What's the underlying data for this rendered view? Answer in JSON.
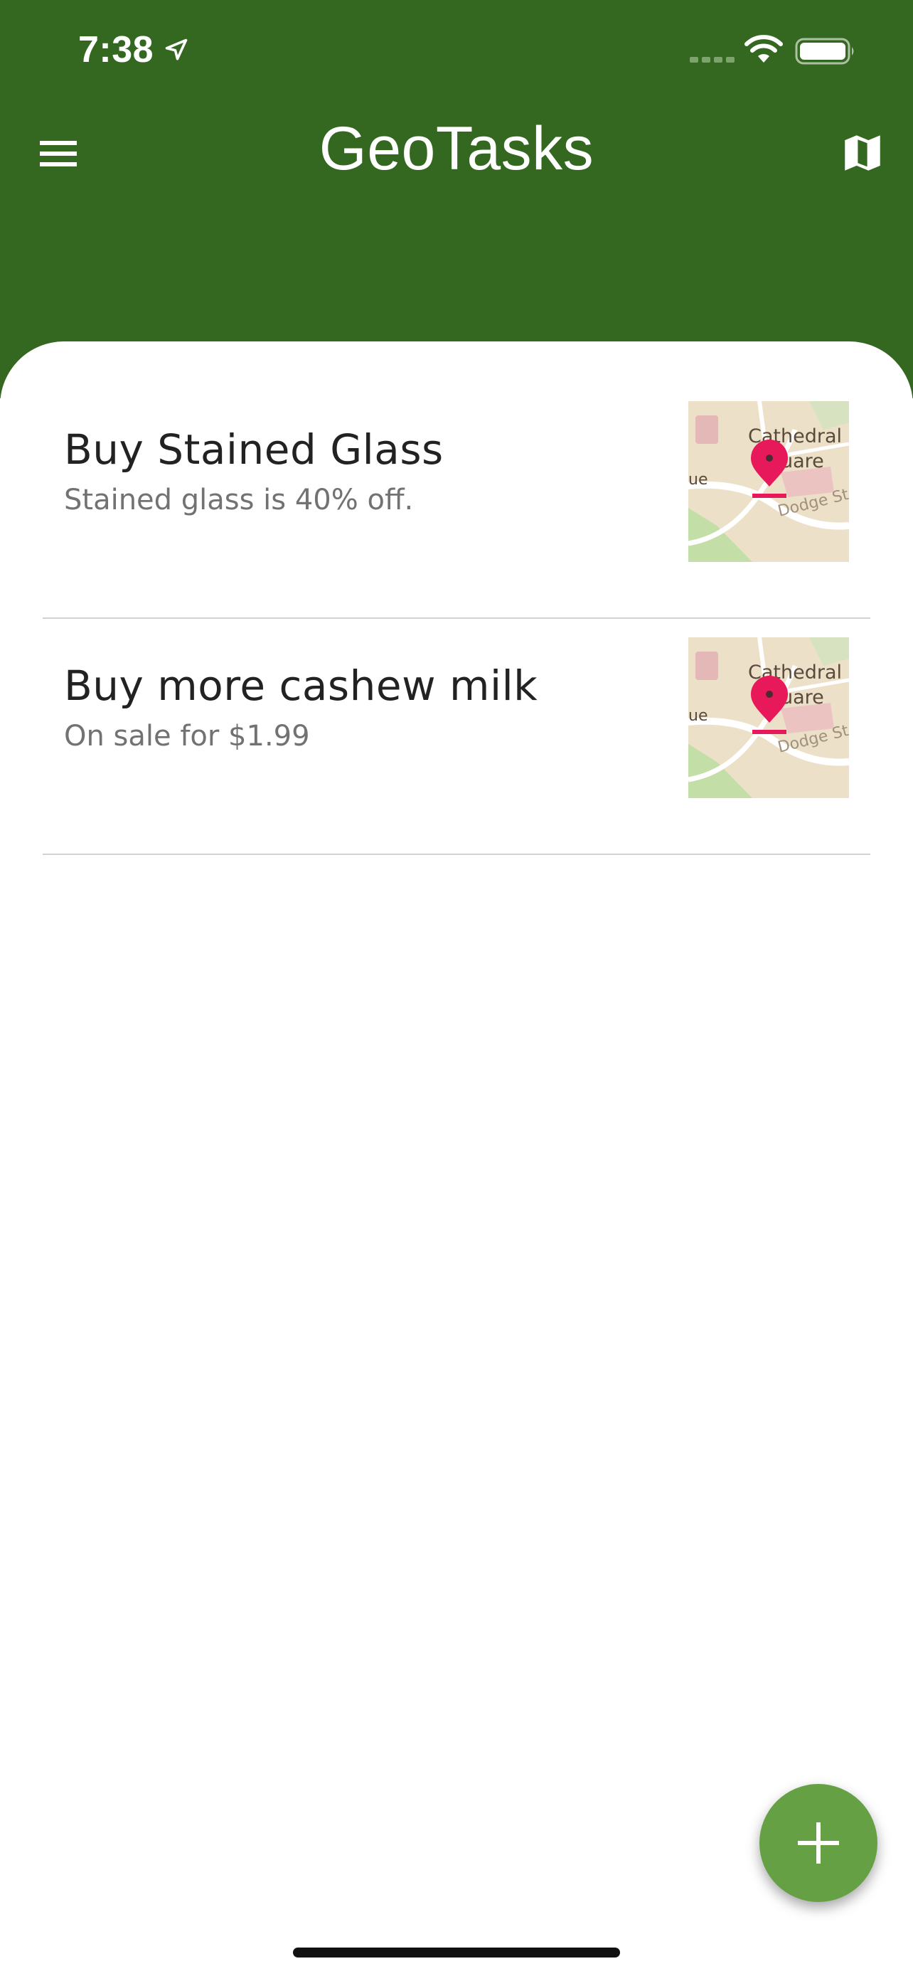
{
  "status_bar": {
    "time": "7:38",
    "icons": [
      "location-arrow-icon",
      "cellular-signal-icon",
      "wifi-icon",
      "battery-icon"
    ]
  },
  "header": {
    "title": "GeoTasks",
    "left_icon": "hamburger-menu-icon",
    "right_icon": "map-icon",
    "background_color": "#346820"
  },
  "tasks": [
    {
      "title": "Buy Stained Glass",
      "description": "Stained glass is 40% off.",
      "map_labels": [
        "Cathedral",
        "uare",
        "ue",
        "Dodge St"
      ]
    },
    {
      "title": "Buy more cashew milk",
      "description": "On sale for $1.99",
      "map_labels": [
        "Cathedral",
        "uare",
        "ue",
        "Dodge St"
      ]
    }
  ],
  "fab": {
    "icon": "plus-icon",
    "color": "#65a045"
  }
}
